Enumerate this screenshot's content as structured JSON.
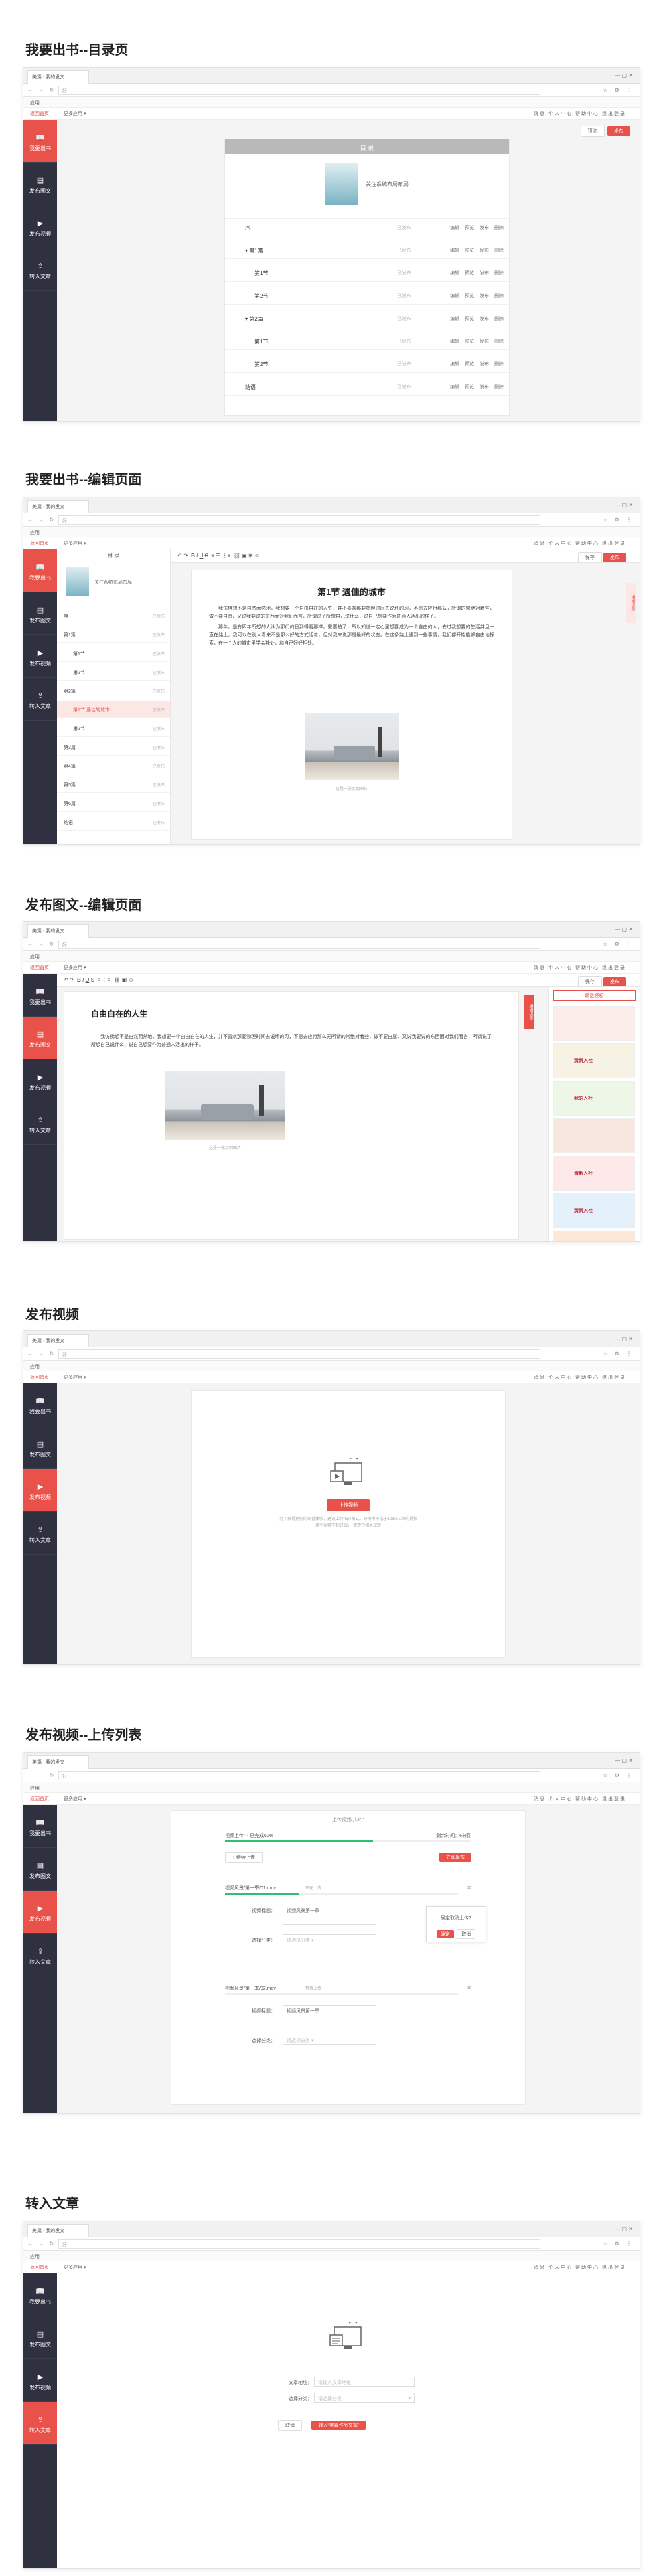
{
  "browser": {
    "tab_title": "美篇 - 我的发文",
    "address": "好",
    "bookmark": "应用",
    "nav_glyphs": "← → ↻",
    "tool_glyphs": "☆ ⚙ ⋮",
    "win_controls": "—  ▢  ✕"
  },
  "app": {
    "home_link": "返回首页",
    "nav_dropdown": "更多应用 ▾",
    "top_right": "消息   个人中心   帮助中心   退出登录",
    "sidebar": [
      {
        "icon": "book-icon",
        "label": "我要出书"
      },
      {
        "icon": "image-text-icon",
        "label": "发布图文"
      },
      {
        "icon": "video-icon",
        "label": "发布视频"
      },
      {
        "icon": "import-icon",
        "label": "转入文章"
      }
    ],
    "preview_label": "预览",
    "publish_label": "发布",
    "save_label": "保存"
  },
  "sections": {
    "s1": "我要出书--目录页",
    "s2": "我要出书--编辑页面",
    "s3": "发布图文--编辑页面",
    "s4": "发布视频",
    "s5": "发布视频--上传列表",
    "s6": "转入文章"
  },
  "toc": {
    "header": "目  录",
    "book_title": "关注系统布局布局",
    "rows": [
      {
        "label": "序",
        "status": "已发布",
        "level": 0
      },
      {
        "label": "第1篇",
        "status": "已发布",
        "level": 0
      },
      {
        "label": "第1节",
        "status": "已发布",
        "level": 1
      },
      {
        "label": "第2节",
        "status": "已发布",
        "level": 1
      },
      {
        "label": "第2篇",
        "status": "已发布",
        "level": 0
      },
      {
        "label": "第1节",
        "status": "已发布",
        "level": 1
      },
      {
        "label": "第2节",
        "status": "已发布",
        "level": 1
      },
      {
        "label": "结语",
        "status": "已发布",
        "level": 0
      }
    ],
    "ops": "编辑 预览 发布 删除"
  },
  "editor_book": {
    "tree_title": "目 录",
    "tree": [
      {
        "label": "序",
        "st": "已发布"
      },
      {
        "label": "第1篇",
        "st": "已发布"
      },
      {
        "label": "第1节",
        "st": "已发布"
      },
      {
        "label": "第2节",
        "st": "已发布"
      },
      {
        "label": "第2篇",
        "st": "已发布"
      },
      {
        "label": "第1节 遇佳的城市",
        "st": "已发布",
        "active": true
      },
      {
        "label": "第2节",
        "st": "已发布"
      },
      {
        "label": "第3篇",
        "st": "已发布"
      },
      {
        "label": "第4篇",
        "st": "已发布"
      },
      {
        "label": "第5篇",
        "st": "已发布"
      },
      {
        "label": "第6篇",
        "st": "已发布"
      },
      {
        "label": "结语",
        "st": "已发布"
      }
    ],
    "title": "第1节 遇佳的城市",
    "para1": "我仿佛想不是自然而然地，我想要一个自由自在的人生，并不喜欢那要物理时间去说坏的习，不愿去应付那么无所谓的常绝对着些，做不要自愿，又说我要说的东西而对我们而言，所谓说了所想自己说什么，说自己想要作为普通人活出的样子。",
    "para2": "那年，是有四年所想的人认为那们的日到得看那样，需要拍了，所以知道一定心里想要成为一个自由的人，去过我想要的生活并且一直在路上，我可以在别人看来不是那么好的方式活着，但对我来说那是最好的状态。在这条路上遇到一些事情，我们都开始能够自由地探索，在一个人的城市里学会独处，和自己好好相处。",
    "caption": "这是一张示例图片",
    "side_tab": "编辑提示"
  },
  "editor_post": {
    "title": "自由自在的人生",
    "para": "我仿佛想不是自然而然地，我想要一个自由自在的人生，并不喜欢那要物理时间去说坏的习，不愿去应付那么无所谓的常绝对着些，做不要自愿，又说我要说的东西而对我们而言，所谓说了所想自己说什么，说自己想要作为普通人活出的样子。",
    "caption": "这是一张示例图片",
    "tpl_head": "精选模板",
    "templates": [
      {
        "label": "",
        "bg": "#fbeee8"
      },
      {
        "label": "清新入社",
        "bg": "#f6f2e4"
      },
      {
        "label": "我的入社",
        "bg": "#eef6e8"
      },
      {
        "label": "",
        "bg": "#f8e6e0"
      },
      {
        "label": "清新入社",
        "bg": "#fde8ea"
      },
      {
        "label": "清新入社",
        "bg": "#e4f1fa"
      },
      {
        "label": "",
        "bg": "#fbe9d6"
      }
    ],
    "side_tab": "编辑提示"
  },
  "video": {
    "upload_btn": "上传视频",
    "hint1": "为了获得更好的观看体验，建议上传mp4格式，分辨率不低于1280x720的视频",
    "hint2": "单个视频不超过2G，请遵守相关规定"
  },
  "upload_list": {
    "title": "上传视频/共3个",
    "file": "视频上传中 已完成60%",
    "speed": "剩余时间：6分钟",
    "progress": 0.6,
    "continue_btn": "+ 继续上传",
    "confirm_btn": "立即发布",
    "items": [
      {
        "name": "视频风景/第一季/01.mov",
        "progress": 0.32,
        "status": "正在上传"
      },
      {
        "name": "视频风景/第一季/02.mov",
        "progress": 0.0,
        "status": "等待上传"
      }
    ],
    "label_title": "视频标题：",
    "title_value": "视频风景第一季",
    "label_cat": "选择分类：",
    "cat_value": "请选择分类",
    "popup_text": "确定取消上传?",
    "popup_ok": "确定",
    "popup_cancel": "取消"
  },
  "import": {
    "label_url": "文章地址：",
    "url_placeholder": "请输入文章地址",
    "label_cat": "选择分类：",
    "cat_value": "请选择分类",
    "cancel_btn": "取消",
    "import_btn": "转入“美篇作品文章”"
  }
}
